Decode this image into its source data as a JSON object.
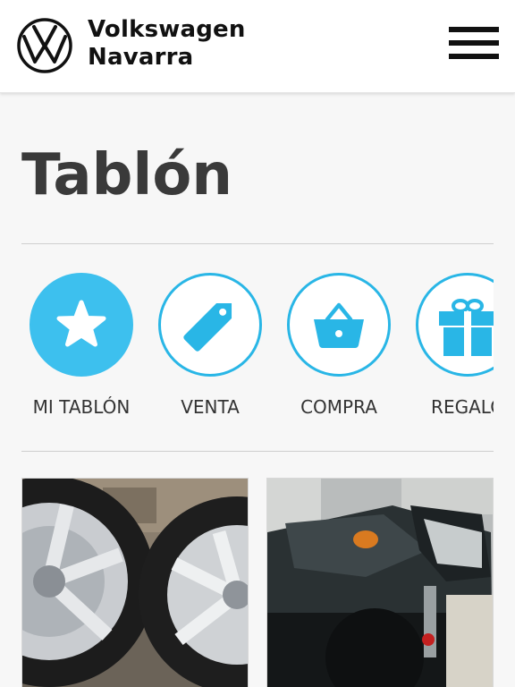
{
  "header": {
    "brand_line1": "Volkswagen",
    "brand_line2": "Navarra"
  },
  "page": {
    "title": "Tablón"
  },
  "categories": [
    {
      "label": "MI TABLÓN",
      "icon": "star-icon",
      "active": true
    },
    {
      "label": "VENTA",
      "icon": "price-tag-icon",
      "active": false
    },
    {
      "label": "COMPRA",
      "icon": "shopping-basket-icon",
      "active": false
    },
    {
      "label": "REGALO",
      "icon": "gift-icon",
      "active": false
    }
  ],
  "listings": [
    {
      "image": "alloy-wheels-photo"
    },
    {
      "image": "motorcycle-photo"
    }
  ],
  "colors": {
    "accent": "#29b6e6",
    "active_fill": "#3dc0ee",
    "title_text": "#3a3a3a"
  }
}
